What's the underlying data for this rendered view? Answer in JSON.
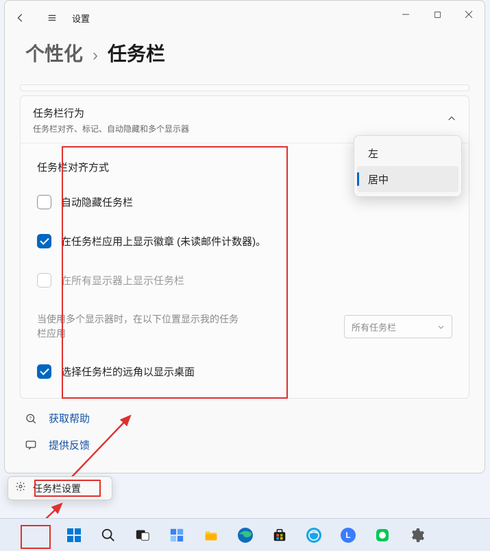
{
  "window": {
    "title": "设置",
    "breadcrumb": {
      "parent": "个性化",
      "sep": "›",
      "current": "任务栏"
    }
  },
  "panel": {
    "title": "任务栏行为",
    "subtitle": "任务栏对齐、标记、自动隐藏和多个显示器"
  },
  "align": {
    "label": "任务栏对齐方式",
    "options": {
      "left": "左",
      "center": "居中"
    },
    "selected": "居中"
  },
  "rows": {
    "autohide": "自动隐藏任务栏",
    "badges": "在任务栏应用上显示徽章 (未读邮件计数器)。",
    "allmon": "在所有显示器上显示任务栏",
    "multi_desc": "当使用多个显示器时，在以下位置显示我的任务栏应用",
    "multi_dd": "所有任务栏",
    "farcorner": "选择任务栏的远角以显示桌面"
  },
  "footer": {
    "help": "获取帮助",
    "feedback": "提供反馈"
  },
  "context_menu": {
    "label": "任务栏设置"
  }
}
